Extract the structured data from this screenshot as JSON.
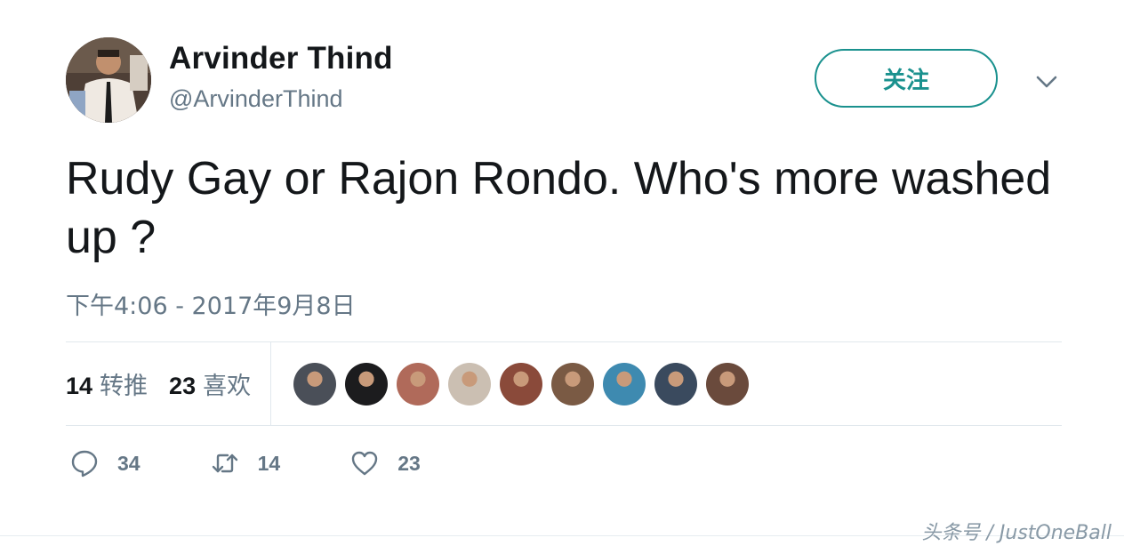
{
  "user": {
    "display_name": "Arvinder Thind",
    "handle": "@ArvinderThind"
  },
  "header": {
    "follow_label": "关注"
  },
  "tweet": {
    "text": "Rudy Gay or Rajon Rondo. Who's more washed up ?",
    "timestamp": "下午4:06 - 2017年9月8日"
  },
  "stats": {
    "retweets_count": "14",
    "retweets_label": "转推",
    "likes_count": "23",
    "likes_label": "喜欢"
  },
  "likers": [
    {
      "name": "liker-1",
      "color": "#4a4f58"
    },
    {
      "name": "liker-2",
      "color": "#1c1c1e"
    },
    {
      "name": "liker-3",
      "color": "#b06a5a"
    },
    {
      "name": "liker-4",
      "color": "#cbbfb2"
    },
    {
      "name": "liker-5",
      "color": "#8a4a3a"
    },
    {
      "name": "liker-6",
      "color": "#7a5a44"
    },
    {
      "name": "liker-7",
      "color": "#3e8ab0"
    },
    {
      "name": "liker-8",
      "color": "#3a4a5e"
    },
    {
      "name": "liker-9",
      "color": "#6a4a3c"
    }
  ],
  "actions": {
    "reply_count": "34",
    "retweet_count": "14",
    "like_count": "23"
  },
  "icons": {
    "reply": "speech-bubble-icon",
    "retweet": "retweet-arrows-icon",
    "like": "heart-outline-icon",
    "more": "chevron-down-icon"
  },
  "colors": {
    "accent": "#1a918e",
    "secondary_text": "#657786",
    "divider": "#e1e8ed"
  },
  "watermark": "头条号 / JustOneBall"
}
